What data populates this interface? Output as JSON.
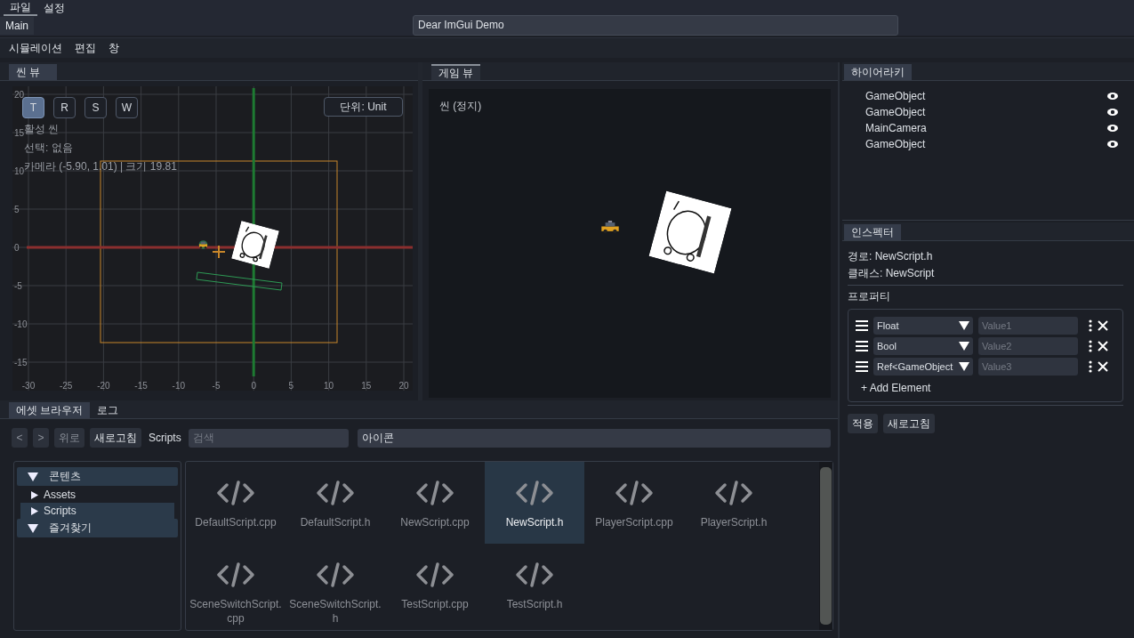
{
  "menu_bar": [
    {
      "label": "파일",
      "selected": true
    },
    {
      "label": "설정",
      "selected": false
    }
  ],
  "doc_tabs": [
    {
      "label": "Main",
      "selected": true
    }
  ],
  "title_field": {
    "value": "Dear ImGui Demo"
  },
  "app_menu": [
    "시뮬레이션",
    "편집",
    "창"
  ],
  "scene_view": {
    "tab": {
      "label": "씬 뷰",
      "focused": false
    },
    "tools": [
      {
        "label": "T",
        "selected": true
      },
      {
        "label": "R",
        "selected": false
      },
      {
        "label": "S",
        "selected": false
      },
      {
        "label": "W",
        "selected": false
      }
    ],
    "unit_button": "단위: Unit",
    "info": [
      "활성 씬",
      "선택: 없음",
      "카메라 (-5.90, 1.01) | 크기 19.81"
    ],
    "x_ticks": [
      "-30",
      "-25",
      "-20",
      "-15",
      "-10",
      "-5",
      "0",
      "5",
      "10",
      "15",
      "20"
    ],
    "y_ticks": [
      "20",
      "15",
      "10",
      "5",
      "0",
      "-5",
      "-10",
      "-15"
    ]
  },
  "game_view": {
    "tab": {
      "label": "게임 뷰",
      "focused": true
    },
    "status": "씬 (정지)"
  },
  "hierarchy": {
    "tab": "하이어라키",
    "items": [
      {
        "name": "GameObject",
        "visible": true
      },
      {
        "name": "GameObject",
        "visible": true
      },
      {
        "name": "MainCamera",
        "visible": true
      },
      {
        "name": "GameObject",
        "visible": true
      }
    ]
  },
  "inspector": {
    "tab": "인스펙터",
    "path": "경로: NewScript.h",
    "class": "클래스: NewScript",
    "properties_label": "프로퍼티",
    "properties": [
      {
        "type": "Float",
        "placeholder": "Value1"
      },
      {
        "type": "Bool",
        "placeholder": "Value2"
      },
      {
        "type": "Ref<GameObject",
        "placeholder": "Value3"
      }
    ],
    "add_button": "+ Add Element",
    "buttons": [
      "적용",
      "새로고침"
    ]
  },
  "asset_browser": {
    "tabs": [
      {
        "label": "에셋 브라우저",
        "selected": true
      },
      {
        "label": "로그",
        "selected": false
      }
    ],
    "toolbar": [
      {
        "label": "<",
        "disabled": true
      },
      {
        "label": ">",
        "disabled": true
      },
      {
        "label": "위로",
        "disabled": true
      },
      {
        "label": "새로고침",
        "disabled": false
      }
    ],
    "path": "Scripts",
    "search": {
      "placeholder": "검색"
    },
    "view_mode": {
      "value": "아이콘"
    },
    "tree": [
      {
        "label": "콘텐츠",
        "expanded": true,
        "children": [
          {
            "label": "Assets",
            "expanded": false,
            "selected": false
          },
          {
            "label": "Scripts",
            "expanded": false,
            "selected": true
          }
        ]
      },
      {
        "label": "즐겨찾기",
        "expanded": true
      }
    ],
    "files": [
      {
        "name": "DefaultScript.cpp",
        "selected": false
      },
      {
        "name": "DefaultScript.h",
        "selected": false
      },
      {
        "name": "NewScript.cpp",
        "selected": false
      },
      {
        "name": "NewScript.h",
        "selected": true
      },
      {
        "name": "PlayerScript.cpp",
        "selected": false
      },
      {
        "name": "PlayerScript.h",
        "selected": false
      },
      {
        "name": "SceneSwitchScript.cpp",
        "selected": false
      },
      {
        "name": "SceneSwitchScript.h",
        "selected": false
      },
      {
        "name": "TestScript.cpp",
        "selected": false
      },
      {
        "name": "TestScript.h",
        "selected": false
      }
    ]
  }
}
